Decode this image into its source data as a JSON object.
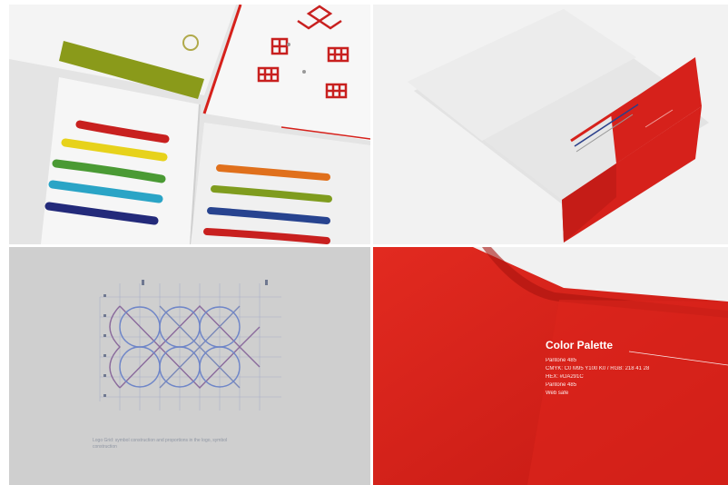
{
  "panels": {
    "top_left": {
      "subject": "open brand guideline pages with color swatches"
    },
    "top_right": {
      "subject": "closed brand guideline booklet with red band"
    },
    "bottom_left": {
      "subject": "logo construction grid",
      "caption_lines": [
        "Logo Grid: symbol construction and proportions in the logo, symbol",
        "construction"
      ]
    },
    "bottom_right": {
      "subject": "red inner spread",
      "title": "Color Palette",
      "lines": [
        "Pantone 485",
        "CMYK: C0 M95 Y100 K0 / RGB: 218 41 28",
        "HEX: #DA291C",
        "Pantone 485",
        "Web safe"
      ]
    }
  },
  "colors": {
    "brand_red": "#d6211b",
    "paper": "#f2f2f2",
    "swatch_red": "#c8201f",
    "swatch_yellow": "#e7d21b",
    "swatch_green": "#4a9a34",
    "swatch_cyan": "#2aa4c6",
    "swatch_navy": "#232a7a",
    "swatch_orange": "#e0701c",
    "swatch_olive": "#7f9c1e",
    "swatch_blue": "#27438f"
  }
}
